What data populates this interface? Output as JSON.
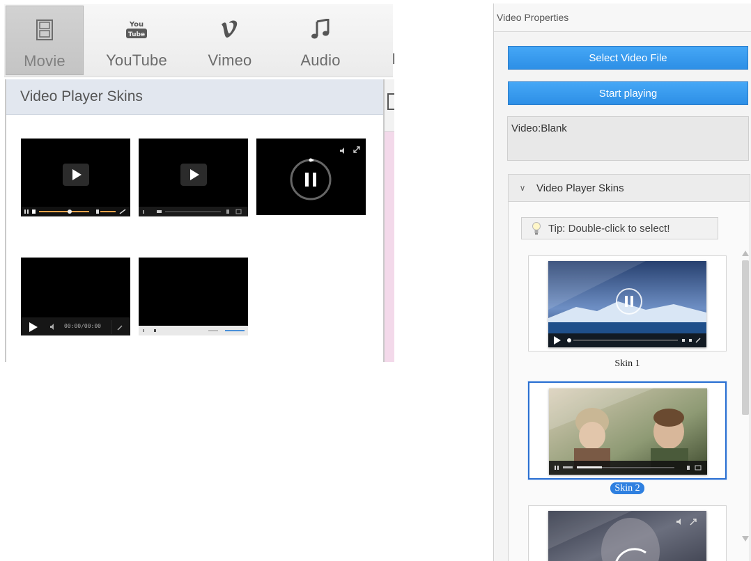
{
  "toolbar": {
    "items": [
      {
        "label": "Movie",
        "icon": "film-icon",
        "active": true
      },
      {
        "label": "YouTube",
        "icon": "youtube-icon",
        "active": false
      },
      {
        "label": "Vimeo",
        "icon": "vimeo-icon",
        "active": false
      },
      {
        "label": "Audio",
        "icon": "music-note-icon",
        "active": false
      }
    ],
    "cut_label": "I"
  },
  "skins_popup": {
    "title": "Video Player Skins",
    "thumbnails": [
      {
        "name": "skin-thumb-1"
      },
      {
        "name": "skin-thumb-2"
      },
      {
        "name": "skin-thumb-3"
      },
      {
        "name": "skin-thumb-4",
        "time": "00:00/00:00"
      },
      {
        "name": "skin-thumb-5"
      }
    ]
  },
  "properties": {
    "title": "Video Properties",
    "select_file_label": "Select Video File",
    "start_playing_label": "Start playing",
    "video_info": "Video:Blank",
    "skins_section": {
      "title": "Video Player Skins",
      "tip": "Tip: Double-click to select!",
      "skins": [
        {
          "label": "Skin 1",
          "selected": false
        },
        {
          "label": "Skin 2",
          "selected": true
        },
        {
          "label": "",
          "selected": false
        }
      ]
    }
  },
  "colors": {
    "accent_blue": "#2d8fe6",
    "selected_border": "#2a6fd1",
    "popup_header": "#e2e7ef"
  }
}
